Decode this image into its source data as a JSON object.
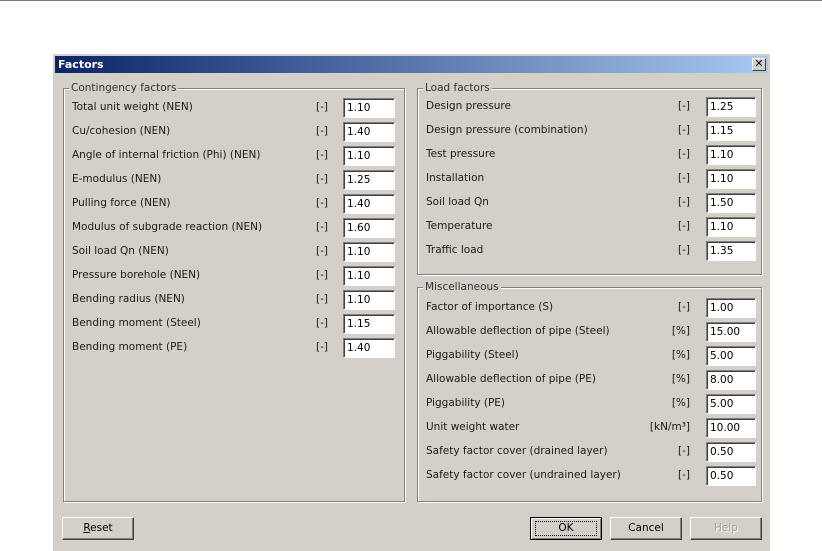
{
  "dialog": {
    "title": "Factors",
    "close_glyph": "✕"
  },
  "contingency": {
    "legend": "Contingency factors",
    "rows": [
      {
        "label": "Total unit weight (NEN)",
        "unit": "[-]",
        "value": "1.10"
      },
      {
        "label": "Cu/cohesion (NEN)",
        "unit": "[-]",
        "value": "1.40"
      },
      {
        "label": "Angle of internal friction (Phi) (NEN)",
        "unit": "[-]",
        "value": "1.10"
      },
      {
        "label": "E-modulus (NEN)",
        "unit": "[-]",
        "value": "1.25"
      },
      {
        "label": "Pulling force (NEN)",
        "unit": "[-]",
        "value": "1.40"
      },
      {
        "label": "Modulus of subgrade reaction (NEN)",
        "unit": "[-]",
        "value": "1.60"
      },
      {
        "label": "Soil load Qn (NEN)",
        "unit": "[-]",
        "value": "1.10"
      },
      {
        "label": "Pressure borehole (NEN)",
        "unit": "[-]",
        "value": "1.10"
      },
      {
        "label": "Bending radius (NEN)",
        "unit": "[-]",
        "value": "1.10"
      },
      {
        "label": "Bending moment (Steel)",
        "unit": "[-]",
        "value": "1.15"
      },
      {
        "label": "Bending moment (PE)",
        "unit": "[-]",
        "value": "1.40"
      }
    ]
  },
  "load": {
    "legend": "Load factors",
    "rows": [
      {
        "label": "Design pressure",
        "unit": "[-]",
        "value": "1.25"
      },
      {
        "label": "Design pressure (combination)",
        "unit": "[-]",
        "value": "1.15"
      },
      {
        "label": "Test pressure",
        "unit": "[-]",
        "value": "1.10"
      },
      {
        "label": "Installation",
        "unit": "[-]",
        "value": "1.10"
      },
      {
        "label": "Soil load Qn",
        "unit": "[-]",
        "value": "1.50"
      },
      {
        "label": "Temperature",
        "unit": "[-]",
        "value": "1.10"
      },
      {
        "label": "Traffic load",
        "unit": "[-]",
        "value": "1.35"
      }
    ]
  },
  "misc": {
    "legend": "Miscellaneous",
    "rows": [
      {
        "label": "Factor of importance  (S)",
        "unit": "[-]",
        "value": "1.00"
      },
      {
        "label": "Allowable deflection of pipe (Steel)",
        "unit": "[%]",
        "value": "15.00"
      },
      {
        "label": "Piggability (Steel)",
        "unit": "[%]",
        "value": "5.00"
      },
      {
        "label": "Allowable deflection of pipe (PE)",
        "unit": "[%]",
        "value": "8.00"
      },
      {
        "label": "Piggability (PE)",
        "unit": "[%]",
        "value": "5.00"
      },
      {
        "label": "Unit weight water",
        "unit": "[kN/m³]",
        "value": "10.00"
      },
      {
        "label": "Safety factor cover (drained layer)",
        "unit": "[-]",
        "value": "0.50"
      },
      {
        "label": "Safety factor cover (undrained layer)",
        "unit": "[-]",
        "value": "0.50"
      }
    ]
  },
  "buttons": {
    "reset_first": "R",
    "reset_rest": "eset",
    "ok": "OK",
    "cancel": "Cancel",
    "help": "Help"
  }
}
